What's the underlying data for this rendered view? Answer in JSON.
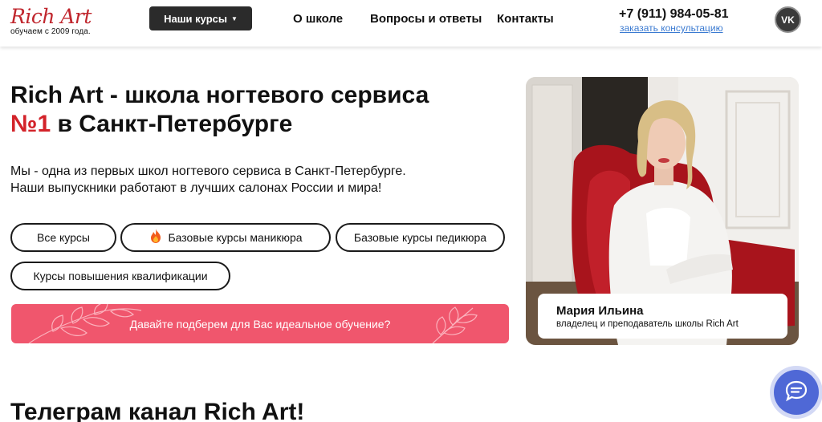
{
  "header": {
    "logo_title": "Rich Art",
    "logo_subtitle": "обучаем с 2009 года.",
    "courses_button": "Наши курсы",
    "nav": [
      "О школе",
      "Вопросы и ответы",
      "Контакты"
    ],
    "phone": "+7 (911) 984-05-81",
    "consult_link": "заказать консультацию",
    "vk_label": "VK"
  },
  "hero": {
    "title_part1": "Rich Art - школа ногтевого сервиса ",
    "title_accent": "№1",
    "title_part2": " в Санкт-Петербурге",
    "desc_line1": "Мы - одна из первых школ ногтевого сервиса в Санкт-Петербурге.",
    "desc_line2": "Наши выпускники работают в лучших салонах России и мира!",
    "filters": [
      "Все курсы",
      "Базовые курсы маникюра",
      "Базовые курсы педикюра",
      "Курсы повышения квалификации"
    ],
    "cta": "Давайте подберем для Вас идеальное обучение?"
  },
  "person": {
    "name": "Мария Ильина",
    "role": "владелец и преподаватель школы Rich Art"
  },
  "section2": {
    "title": "Телеграм канал Rich Art!"
  },
  "colors": {
    "accent_red": "#d3232a",
    "cta_pink": "#f0566d",
    "link_blue": "#3a7ad1",
    "chat_blue": "#4f68d6"
  },
  "icons": [
    "caret-down-icon",
    "vk-icon",
    "fire-icon",
    "chat-icon"
  ]
}
